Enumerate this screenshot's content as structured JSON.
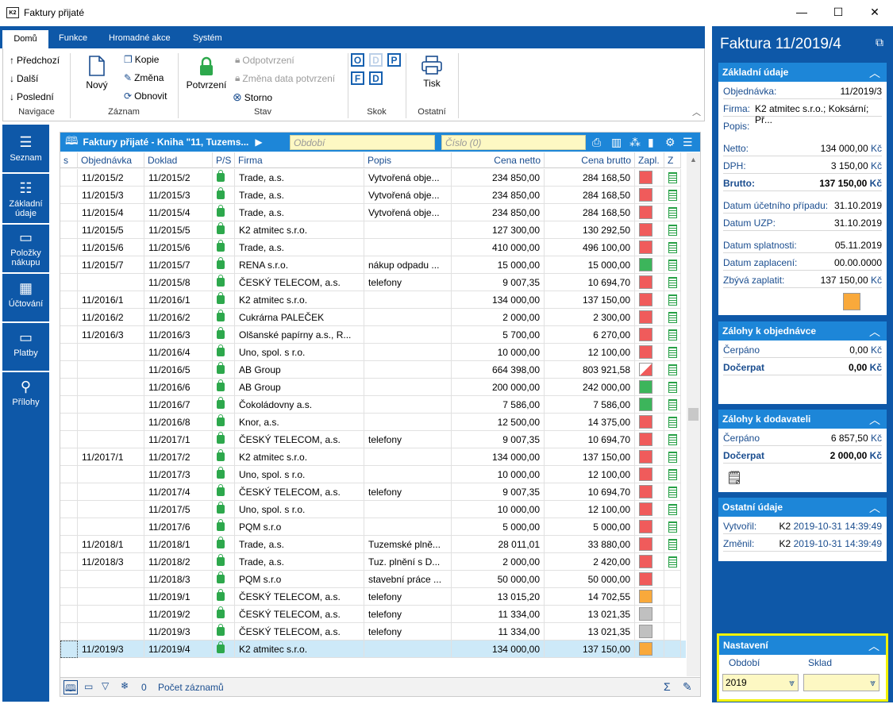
{
  "window": {
    "title": "Faktury přijaté",
    "logo": "K2",
    "minimize": "—",
    "maximize": "☐",
    "close": "✕"
  },
  "ribbon": {
    "tabs": [
      "Domů",
      "Funkce",
      "Hromadné akce",
      "Systém"
    ],
    "navigace": {
      "label": "Navigace",
      "prev": "Předchozí",
      "next": "Další",
      "last": "Poslední"
    },
    "zaznam": {
      "label": "Záznam",
      "new": "Nový",
      "copy": "Kopie",
      "change": "Změna",
      "refresh": "Obnovit"
    },
    "stav": {
      "label": "Stav",
      "confirm": "Potvrzení",
      "unconfirm": "Odpotvrzení",
      "change_date": "Změna data potvrzení",
      "storno": "Storno"
    },
    "skok": {
      "label": "Skok",
      "letters": [
        "O",
        "D",
        "P",
        "F",
        "D"
      ]
    },
    "ostatni": {
      "label": "Ostatní",
      "print": "Tisk"
    }
  },
  "leftnav": [
    {
      "label": "Seznam",
      "icon": "list-icon"
    },
    {
      "label": "Základní údaje",
      "icon": "details-icon"
    },
    {
      "label": "Položky nákupu",
      "icon": "box-icon"
    },
    {
      "label": "Účtování",
      "icon": "calculator-icon"
    },
    {
      "label": "Platby",
      "icon": "archive-icon"
    },
    {
      "label": "Přílohy",
      "icon": "paperclip-icon"
    }
  ],
  "grid": {
    "title": "Faktury přijaté - Kniha \"11, Tuzems...",
    "period_placeholder": "Období",
    "number_placeholder": "Číslo (0)",
    "columns": [
      "s",
      "Objednávka",
      "Doklad",
      "P/S",
      "Firma",
      "Popis",
      "Cena netto",
      "Cena brutto",
      "Zapl.",
      "Z"
    ],
    "rows": [
      [
        "",
        "11/2015/2",
        "11/2015/2",
        "Trade, a.s.",
        "Vytvořená obje...",
        "234 850,00",
        "284 168,50",
        "red"
      ],
      [
        "",
        "11/2015/3",
        "11/2015/3",
        "Trade, a.s.",
        "Vytvořená obje...",
        "234 850,00",
        "284 168,50",
        "red"
      ],
      [
        "",
        "11/2015/4",
        "11/2015/4",
        "Trade, a.s.",
        "Vytvořená obje...",
        "234 850,00",
        "284 168,50",
        "red"
      ],
      [
        "",
        "11/2015/5",
        "11/2015/5",
        "K2 atmitec s.r.o.",
        "",
        "127 300,00",
        "130 292,50",
        "red"
      ],
      [
        "",
        "11/2015/6",
        "11/2015/6",
        "Trade, a.s.",
        "",
        "410 000,00",
        "496 100,00",
        "red"
      ],
      [
        "",
        "11/2015/7",
        "11/2015/7",
        "RENA s.r.o.",
        "nákup odpadu ...",
        "15 000,00",
        "15 000,00",
        "green"
      ],
      [
        "",
        "",
        "11/2015/8",
        "ČESKÝ TELECOM, a.s.",
        "telefony",
        "9 007,35",
        "10 694,70",
        "red"
      ],
      [
        "",
        "11/2016/1",
        "11/2016/1",
        "K2 atmitec s.r.o.",
        "",
        "134 000,00",
        "137 150,00",
        "red"
      ],
      [
        "",
        "11/2016/2",
        "11/2016/2",
        "Cukrárna PALEČEK",
        "",
        "2 000,00",
        "2 300,00",
        "red"
      ],
      [
        "",
        "11/2016/3",
        "11/2016/3",
        "Olšanské papírny a.s., R...",
        "",
        "5 700,00",
        "6 270,00",
        "red"
      ],
      [
        "",
        "",
        "11/2016/4",
        "Uno, spol. s r.o.",
        "",
        "10 000,00",
        "12 100,00",
        "red"
      ],
      [
        "",
        "",
        "11/2016/5",
        "AB Group",
        "",
        "664 398,00",
        "803 921,58",
        "partial"
      ],
      [
        "",
        "",
        "11/2016/6",
        "AB Group",
        "",
        "200 000,00",
        "242 000,00",
        "green"
      ],
      [
        "",
        "",
        "11/2016/7",
        "Čokoládovny a.s.",
        "",
        "7 586,00",
        "7 586,00",
        "green"
      ],
      [
        "",
        "",
        "11/2016/8",
        "Knor, a.s.",
        "",
        "12 500,00",
        "14 375,00",
        "red"
      ],
      [
        "",
        "",
        "11/2017/1",
        "ČESKÝ TELECOM, a.s.",
        "telefony",
        "9 007,35",
        "10 694,70",
        "red"
      ],
      [
        "",
        "11/2017/1",
        "11/2017/2",
        "K2 atmitec s.r.o.",
        "",
        "134 000,00",
        "137 150,00",
        "red"
      ],
      [
        "",
        "",
        "11/2017/3",
        "Uno, spol. s r.o.",
        "",
        "10 000,00",
        "12 100,00",
        "red"
      ],
      [
        "",
        "",
        "11/2017/4",
        "ČESKÝ TELECOM, a.s.",
        "telefony",
        "9 007,35",
        "10 694,70",
        "red"
      ],
      [
        "",
        "",
        "11/2017/5",
        "Uno, spol. s r.o.",
        "",
        "10 000,00",
        "12 100,00",
        "red"
      ],
      [
        "",
        "",
        "11/2017/6",
        "PQM s.r.o",
        "",
        "5 000,00",
        "5 000,00",
        "red"
      ],
      [
        "",
        "11/2018/1",
        "11/2018/1",
        "Trade, a.s.",
        "Tuzemské plně...",
        "28 011,01",
        "33 880,00",
        "red"
      ],
      [
        "",
        "11/2018/3",
        "11/2018/2",
        "Trade, a.s.",
        "Tuz. plnění s D...",
        "2 000,00",
        "2 420,00",
        "red"
      ],
      [
        "",
        "",
        "11/2018/3",
        "PQM s.r.o",
        "stavební práce ...",
        "50 000,00",
        "50 000,00",
        "red"
      ],
      [
        "",
        "",
        "11/2019/1",
        "ČESKÝ TELECOM, a.s.",
        "telefony",
        "13 015,20",
        "14 702,55",
        "orange"
      ],
      [
        "",
        "",
        "11/2019/2",
        "ČESKÝ TELECOM, a.s.",
        "telefony",
        "11 334,00",
        "13 021,35",
        "gray"
      ],
      [
        "",
        "",
        "11/2019/3",
        "ČESKÝ TELECOM, a.s.",
        "telefony",
        "11 334,00",
        "13 021,35",
        "gray"
      ],
      [
        "",
        "11/2019/3",
        "11/2019/4",
        "K2 atmitec s.r.o.",
        "",
        "134 000,00",
        "137 150,00",
        "orange"
      ]
    ],
    "bottom": {
      "count": "0",
      "records_label": "Počet záznamů",
      "sum": "Σ"
    }
  },
  "panel": {
    "title": "Faktura 11/2019/4",
    "zakladni": {
      "head": "Základní údaje",
      "objednavka_l": "Objednávka:",
      "objednavka_v": "11/2019/3",
      "firma_l": "Firma:",
      "firma_v": "K2 atmitec s.r.o.; Koksární; Př...",
      "popis_l": "Popis:",
      "netto_l": "Netto:",
      "netto_v": "134 000,00",
      "dph_l": "DPH:",
      "dph_v": "3 150,00",
      "brutto_l": "Brutto:",
      "brutto_v": "137 150,00",
      "ducp_l": "Datum účetního případu:",
      "ducp_v": "31.10.2019",
      "duzp_l": "Datum UZP:",
      "duzp_v": "31.10.2019",
      "dspl_l": "Datum splatnosti:",
      "dspl_v": "05.11.2019",
      "dzap_l": "Datum zaplacení:",
      "dzap_v": "00.00.0000",
      "zbyva_l": "Zbývá zaplatit:",
      "zbyva_v": "137 150,00",
      "currency": "Kč"
    },
    "zalohy_obj": {
      "head": "Zálohy k objednávce",
      "cerpano_l": "Čerpáno",
      "cerpano_v": "0,00",
      "docerpat_l": "Dočerpat",
      "docerpat_v": "0,00"
    },
    "zalohy_dod": {
      "head": "Zálohy k dodavateli",
      "cerpano_l": "Čerpáno",
      "cerpano_v": "6 857,50",
      "docerpat_l": "Dočerpat",
      "docerpat_v": "2 000,00"
    },
    "ostatni": {
      "head": "Ostatní údaje",
      "vytvoril_l": "Vytvořil:",
      "vytvoril_u": "K2",
      "vytvoril_d": "2019-10-31 14:39:49",
      "zmenil_l": "Změnil:",
      "zmenil_u": "K2",
      "zmenil_d": "2019-10-31 14:39:49"
    },
    "nastaveni": {
      "head": "Nastavení",
      "obdobi_l": "Období",
      "obdobi_v": "2019",
      "sklad_l": "Sklad",
      "sklad_v": ""
    }
  },
  "colors": {
    "accent": "#0e58a8",
    "header": "#1d86d8",
    "red": "#f05b5b",
    "green": "#3cb55b",
    "orange": "#f9a93b",
    "gray": "#c0c0c0",
    "highlight": "#f2f200"
  }
}
